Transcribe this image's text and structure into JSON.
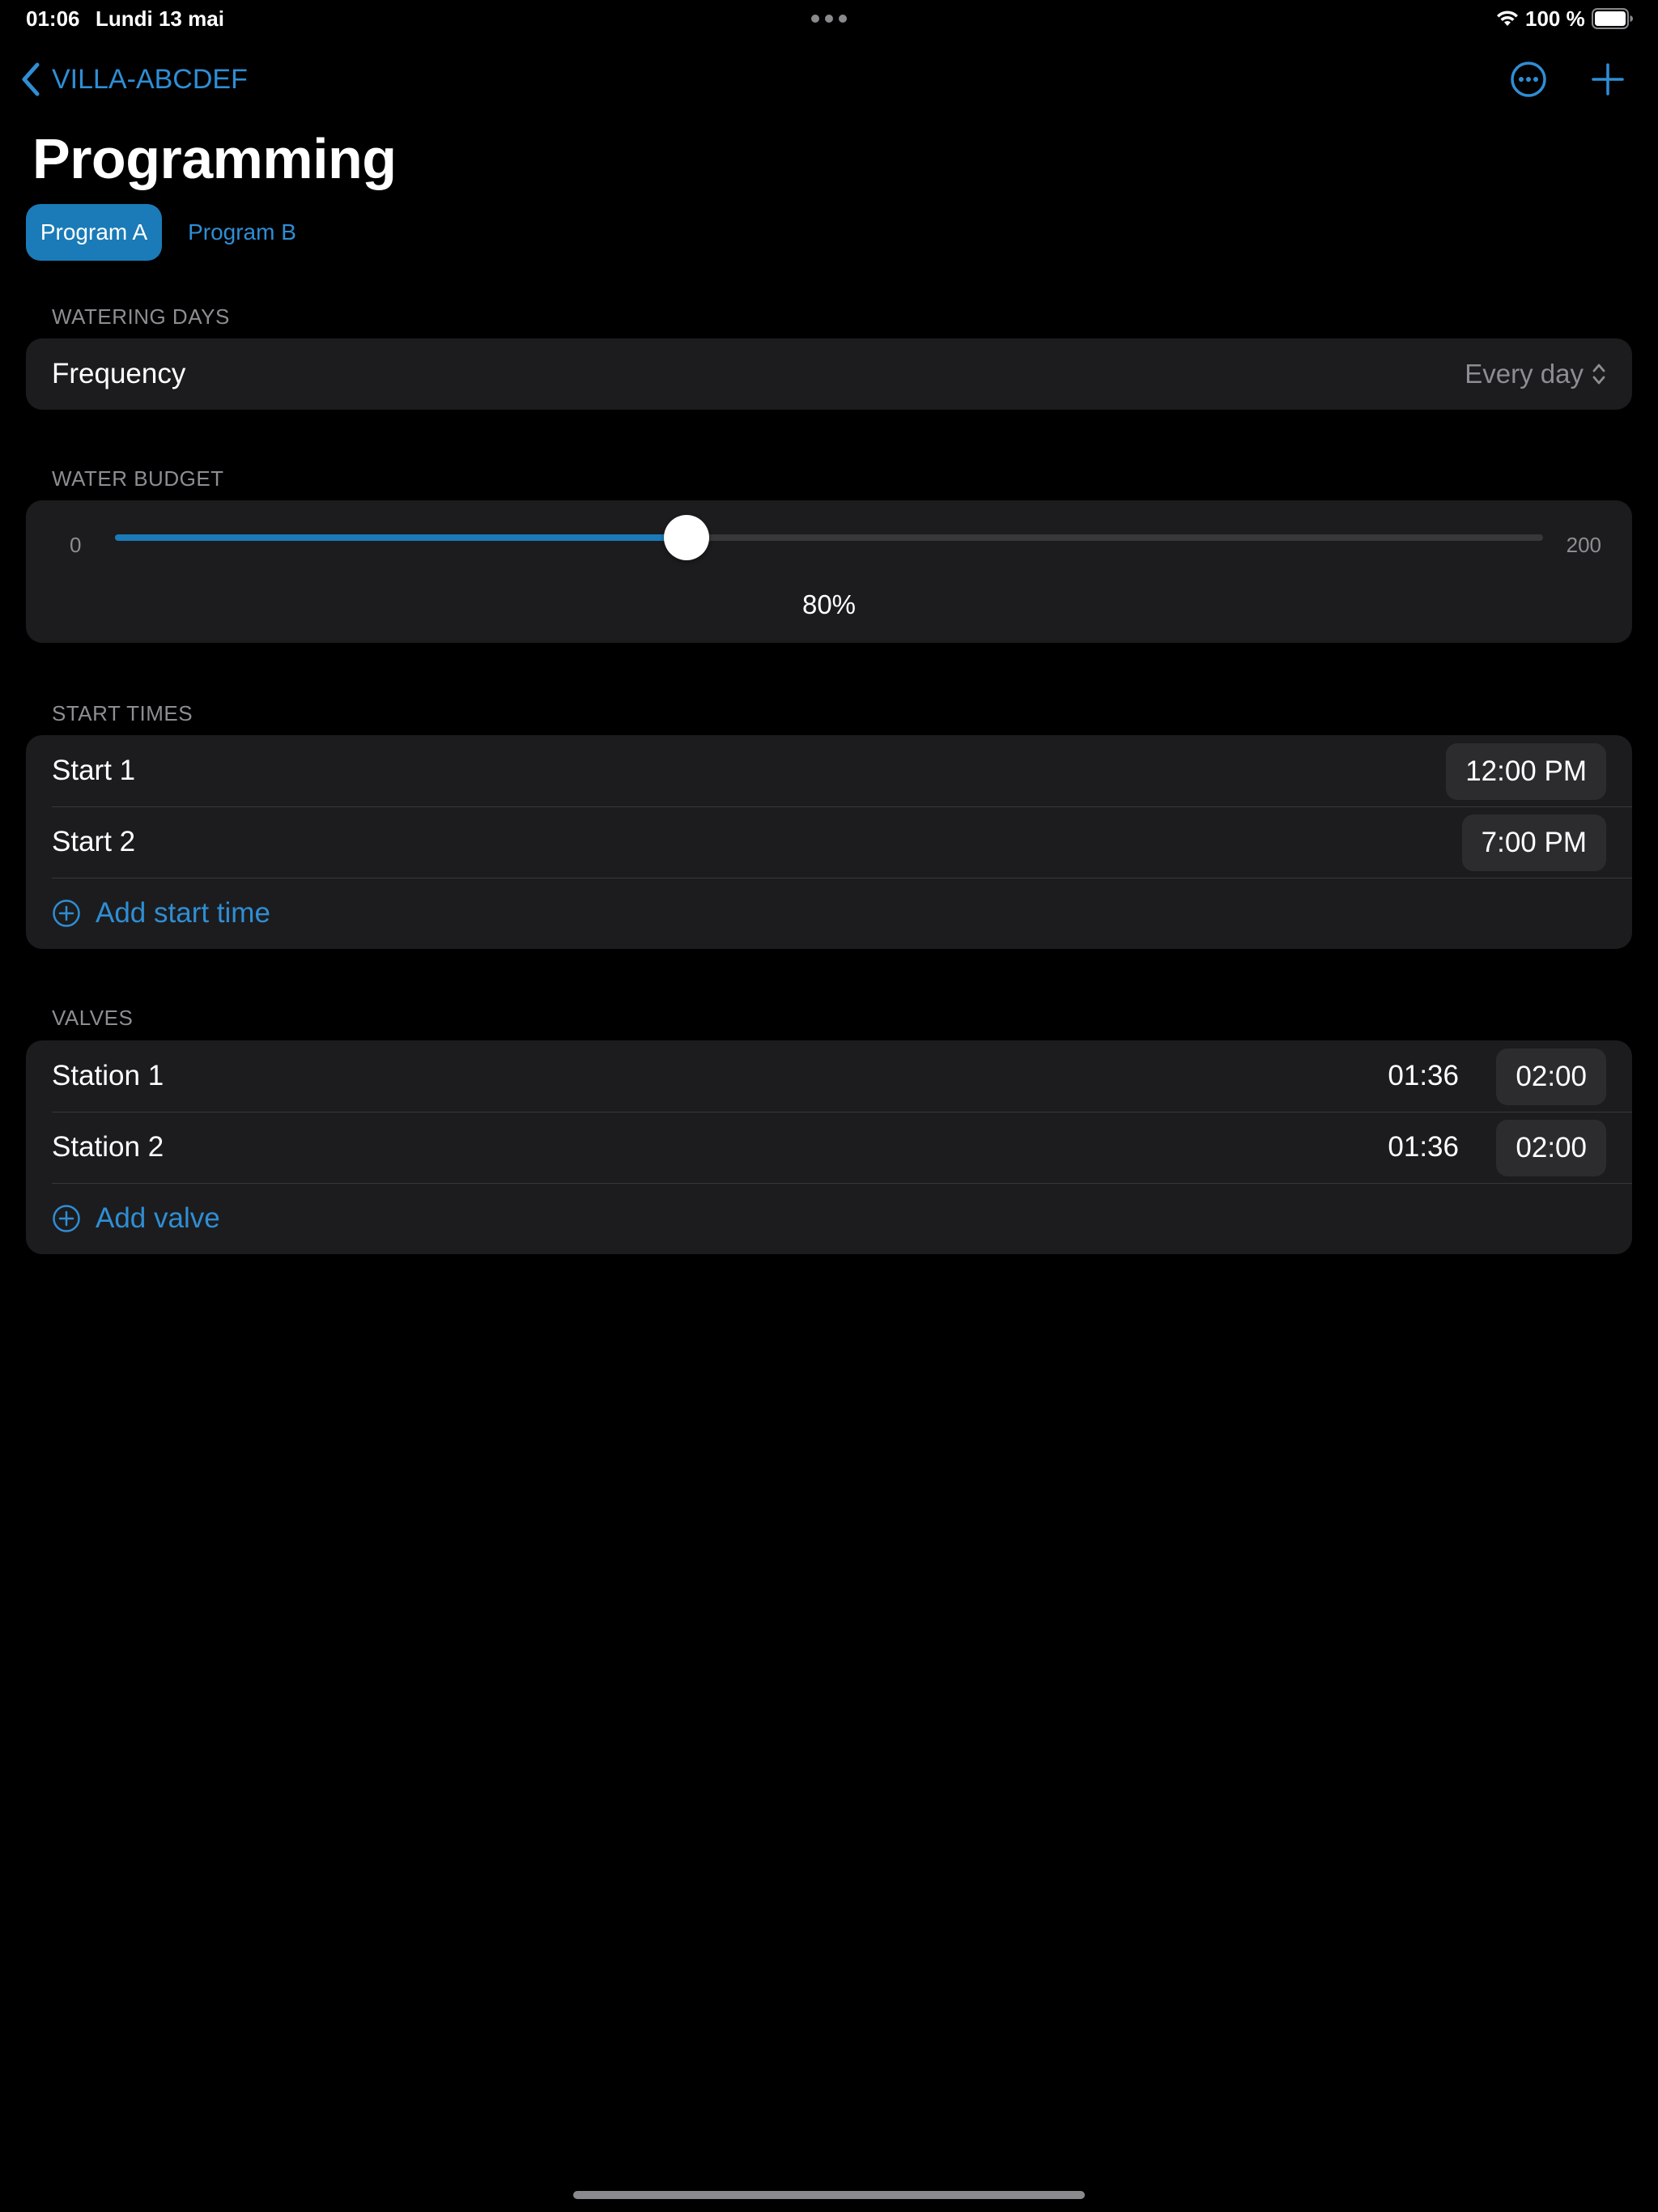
{
  "status_bar": {
    "time": "01:06",
    "date": "Lundi 13 mai",
    "battery": "100 %"
  },
  "nav": {
    "back_label": "VILLA-ABCDEF"
  },
  "page": {
    "title": "Programming"
  },
  "tabs": [
    {
      "label": "Program A",
      "selected": true
    },
    {
      "label": "Program B",
      "selected": false
    }
  ],
  "watering_days": {
    "header": "WATERING DAYS",
    "frequency_label": "Frequency",
    "frequency_value": "Every day"
  },
  "water_budget": {
    "header": "WATER BUDGET",
    "min_label": "0",
    "max_label": "200",
    "min": 0,
    "max": 200,
    "value": 80,
    "value_label": "80%"
  },
  "start_times": {
    "header": "START TIMES",
    "items": [
      {
        "label": "Start 1",
        "time": "12:00 PM"
      },
      {
        "label": "Start 2",
        "time": "7:00 PM"
      }
    ],
    "add_label": "Add start time"
  },
  "valves": {
    "header": "VALVES",
    "items": [
      {
        "label": "Station 1",
        "adjusted": "01:36",
        "duration": "02:00"
      },
      {
        "label": "Station 2",
        "adjusted": "01:36",
        "duration": "02:00"
      }
    ],
    "add_label": "Add valve"
  },
  "colors": {
    "accent": "#2f8ed4",
    "selected_tab": "#1a7bb8",
    "card": "#1c1c1e",
    "background": "#000000",
    "secondary_text": "#8d8d93"
  },
  "icons": {
    "back": "chevron-left-icon",
    "more": "ellipsis-circle-icon",
    "add": "plus-icon",
    "updown": "chevron-up-down-icon",
    "add_row": "plus-circle-icon",
    "wifi": "wifi-icon",
    "battery": "battery-icon",
    "multitask": "multitask-dots-icon"
  }
}
